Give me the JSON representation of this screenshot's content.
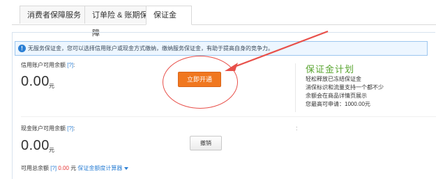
{
  "tabs": [
    {
      "label": "消费者保障服务"
    },
    {
      "label": "订单险 & 账期保障"
    },
    {
      "label": "保证金"
    }
  ],
  "notice": {
    "icon": "info-icon",
    "text": "无服务保证金，您可以选择信用账户或现金方式缴纳，缴纳服务保证金，有助于提高自身的竞争力。"
  },
  "credit": {
    "label": "信用账户可用余额",
    "help": "[?]",
    "colon": ":",
    "amount": "0.00",
    "unit": "元",
    "open_button": "立即开通"
  },
  "plan": {
    "title": "保证金计划",
    "lines": [
      "轻松释放已冻结保证金",
      "消保标识和流量支持一个都不少",
      "余额会在商品详情页展示",
      "您最高可申请：1000.00元"
    ]
  },
  "cash": {
    "label": "现金账户可用余额",
    "help": "[?]",
    "colon": ":",
    "amount": "0.00",
    "unit": "元",
    "withdraw_button": "撤销",
    "side_mark": ":"
  },
  "footer": {
    "prefix": "可用总余额",
    "help": "[?]",
    "value": "0.00",
    "unit": "元",
    "calculator": "保证金额度计算器"
  },
  "colors": {
    "accent": "#f0771f",
    "link": "#2b7fd4",
    "plan_green": "#5aa531",
    "annotation_red": "#e8504a"
  }
}
